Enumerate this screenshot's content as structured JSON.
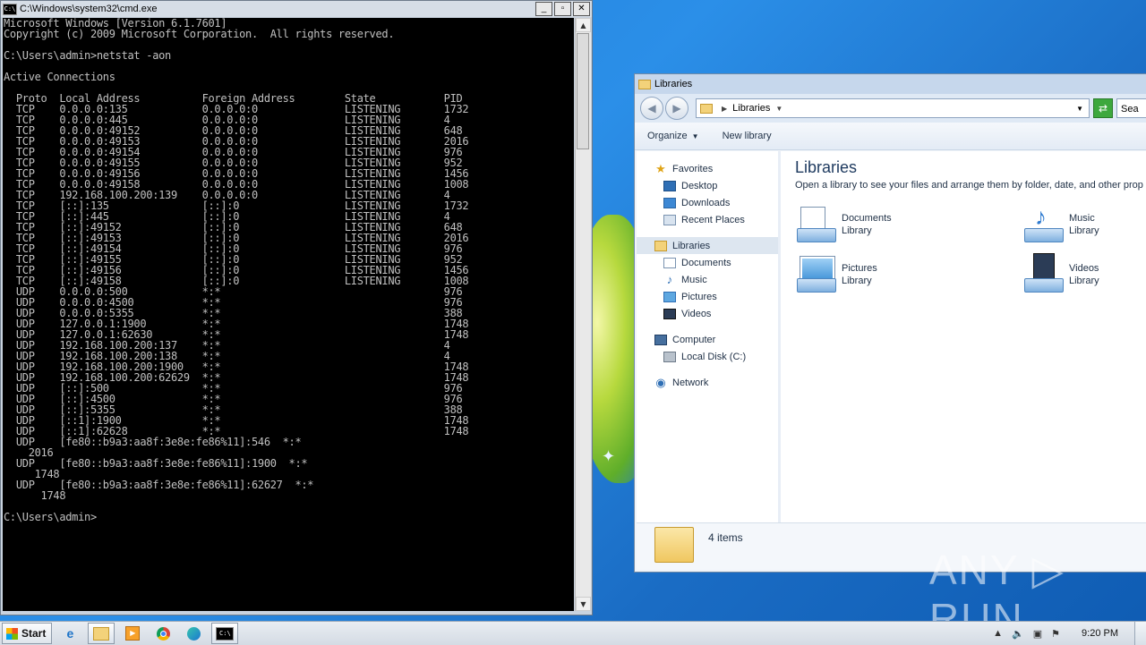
{
  "cmd": {
    "title": "C:\\Windows\\system32\\cmd.exe",
    "icon_label": "C:\\",
    "window_buttons": {
      "minimize": "_",
      "maximize": "▫",
      "close": "✕"
    },
    "output": "Microsoft Windows [Version 6.1.7601]\nCopyright (c) 2009 Microsoft Corporation.  All rights reserved.\n\nC:\\Users\\admin>netstat -aon\n\nActive Connections\n\n  Proto  Local Address          Foreign Address        State           PID\n  TCP    0.0.0.0:135            0.0.0.0:0              LISTENING       1732\n  TCP    0.0.0.0:445            0.0.0.0:0              LISTENING       4\n  TCP    0.0.0.0:49152          0.0.0.0:0              LISTENING       648\n  TCP    0.0.0.0:49153          0.0.0.0:0              LISTENING       2016\n  TCP    0.0.0.0:49154          0.0.0.0:0              LISTENING       976\n  TCP    0.0.0.0:49155          0.0.0.0:0              LISTENING       952\n  TCP    0.0.0.0:49156          0.0.0.0:0              LISTENING       1456\n  TCP    0.0.0.0:49158          0.0.0.0:0              LISTENING       1008\n  TCP    192.168.100.200:139    0.0.0.0:0              LISTENING       4\n  TCP    [::]:135               [::]:0                 LISTENING       1732\n  TCP    [::]:445               [::]:0                 LISTENING       4\n  TCP    [::]:49152             [::]:0                 LISTENING       648\n  TCP    [::]:49153             [::]:0                 LISTENING       2016\n  TCP    [::]:49154             [::]:0                 LISTENING       976\n  TCP    [::]:49155             [::]:0                 LISTENING       952\n  TCP    [::]:49156             [::]:0                 LISTENING       1456\n  TCP    [::]:49158             [::]:0                 LISTENING       1008\n  UDP    0.0.0.0:500            *:*                                    976\n  UDP    0.0.0.0:4500           *:*                                    976\n  UDP    0.0.0.0:5355           *:*                                    388\n  UDP    127.0.0.1:1900         *:*                                    1748\n  UDP    127.0.0.1:62630        *:*                                    1748\n  UDP    192.168.100.200:137    *:*                                    4\n  UDP    192.168.100.200:138    *:*                                    4\n  UDP    192.168.100.200:1900   *:*                                    1748\n  UDP    192.168.100.200:62629  *:*                                    1748\n  UDP    [::]:500               *:*                                    976\n  UDP    [::]:4500              *:*                                    976\n  UDP    [::]:5355              *:*                                    388\n  UDP    [::1]:1900             *:*                                    1748\n  UDP    [::1]:62628            *:*                                    1748\n  UDP    [fe80::b9a3:aa8f:3e8e:fe86%11]:546  *:*\n    2016\n  UDP    [fe80::b9a3:aa8f:3e8e:fe86%11]:1900  *:*\n     1748\n  UDP    [fe80::b9a3:aa8f:3e8e:fe86%11]:62627  *:*\n      1748\n\nC:\\Users\\admin>"
  },
  "explorer": {
    "title": "Libraries",
    "address": "Libraries",
    "search_placeholder": "Sea",
    "toolbar": {
      "organize": "Organize",
      "new_library": "New library"
    },
    "nav": {
      "favorites": "Favorites",
      "desktop": "Desktop",
      "downloads": "Downloads",
      "recent_places": "Recent Places",
      "libraries": "Libraries",
      "documents": "Documents",
      "music": "Music",
      "pictures": "Pictures",
      "videos": "Videos",
      "computer": "Computer",
      "local_disk": "Local Disk (C:)",
      "network": "Network"
    },
    "content": {
      "heading": "Libraries",
      "description": "Open a library to see your files and arrange them by folder, date, and other prop",
      "libraries": [
        {
          "name": "Documents",
          "type": "Library"
        },
        {
          "name": "Music",
          "type": "Library"
        },
        {
          "name": "Pictures",
          "type": "Library"
        },
        {
          "name": "Videos",
          "type": "Library"
        }
      ]
    },
    "status": "4 items"
  },
  "taskbar": {
    "start_label": "Start",
    "clock": "9:20 PM",
    "cmd_icon_label": "C:\\"
  },
  "watermark": "ANY ▷ RUN"
}
